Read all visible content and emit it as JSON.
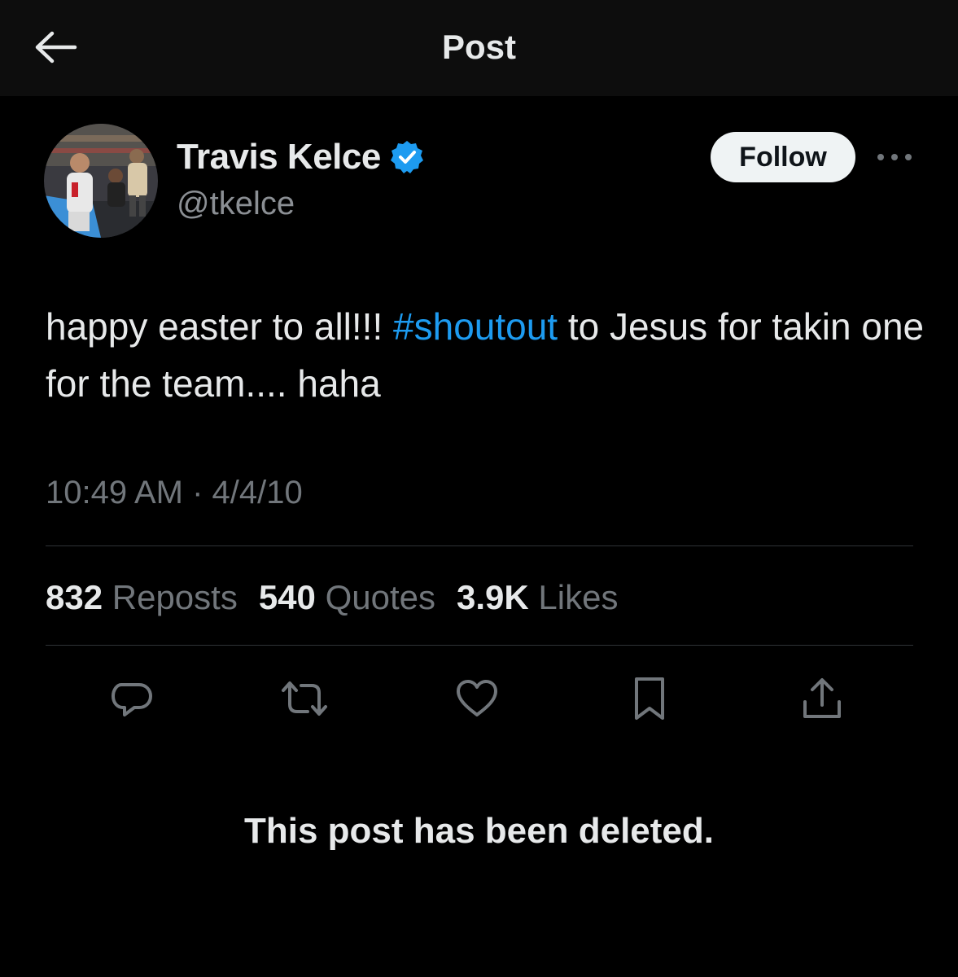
{
  "header": {
    "title": "Post",
    "back_icon": "arrow-left-icon"
  },
  "author": {
    "name": "Travis Kelce",
    "handle": "@tkelce",
    "verified": true,
    "verified_color": "#1d9bf0",
    "follow_label": "Follow"
  },
  "post": {
    "text_before": "happy easter to all!!! ",
    "hashtag": "#shoutout",
    "text_after": " to Jesus for takin one for the team.... haha",
    "timestamp": "10:49 AM · 4/4/10"
  },
  "stats": {
    "reposts_count": "832",
    "reposts_label": "Reposts",
    "quotes_count": "540",
    "quotes_label": "Quotes",
    "likes_count": "3.9K",
    "likes_label": "Likes"
  },
  "actions": [
    "reply-icon",
    "repost-icon",
    "like-icon",
    "bookmark-icon",
    "share-icon"
  ],
  "notice": "This post has been deleted.",
  "colors": {
    "accent": "#1d9bf0",
    "background": "#000000",
    "text": "#e7e9ea",
    "muted": "#71767b"
  }
}
